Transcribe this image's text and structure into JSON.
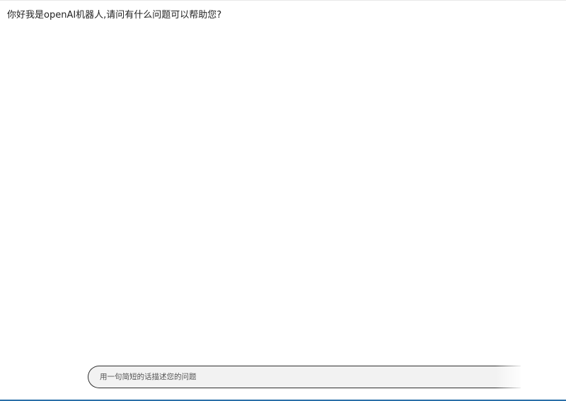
{
  "chat": {
    "messages": [
      {
        "role": "bot",
        "text": "你好我是openAI机器人,请问有什么问题可以帮助您?"
      }
    ]
  },
  "input": {
    "value": "",
    "placeholder": "用一句简短的话描述您的问题"
  },
  "colors": {
    "background": "#ffffff",
    "input_background": "#f2f2f2",
    "input_border": "#2f2f2f",
    "text": "#222222",
    "bottom_accent": "#2a6fa8"
  }
}
